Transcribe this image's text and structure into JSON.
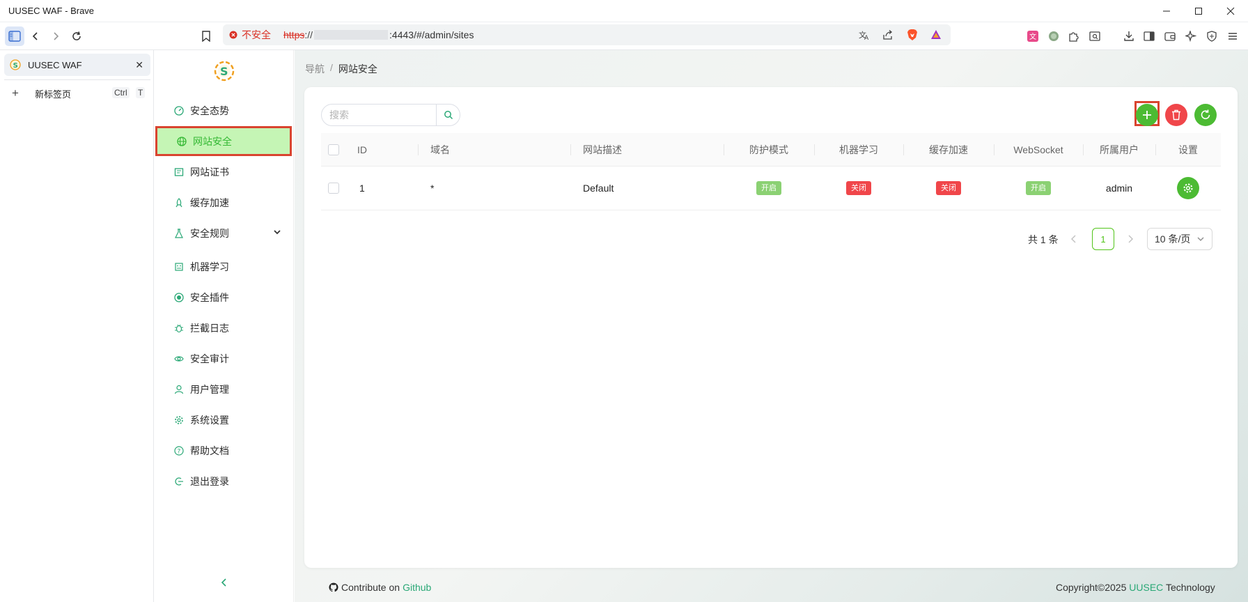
{
  "window": {
    "title": "UUSEC WAF - Brave"
  },
  "browser": {
    "url_security": "不安全",
    "url_protocol": "https",
    "url_separator": "://",
    "url_path": ":4443/#/admin/sites",
    "tab_title": "UUSEC WAF",
    "new_tab_label": "新标签页",
    "new_tab_shortcut_key1": "Ctrl",
    "new_tab_shortcut_key2": "T"
  },
  "sidebar": {
    "items": [
      {
        "label": "安全态势",
        "icon": "dashboard-icon"
      },
      {
        "label": "网站安全",
        "icon": "globe-icon"
      },
      {
        "label": "网站证书",
        "icon": "certificate-icon"
      },
      {
        "label": "缓存加速",
        "icon": "rocket-icon"
      },
      {
        "label": "安全规则",
        "icon": "flask-icon"
      },
      {
        "label": "机器学习",
        "icon": "robot-icon"
      },
      {
        "label": "安全插件",
        "icon": "plugin-icon"
      },
      {
        "label": "拦截日志",
        "icon": "bug-icon"
      },
      {
        "label": "安全审计",
        "icon": "eye-icon"
      },
      {
        "label": "用户管理",
        "icon": "user-icon"
      },
      {
        "label": "系统设置",
        "icon": "gear-icon"
      },
      {
        "label": "帮助文档",
        "icon": "help-icon"
      },
      {
        "label": "退出登录",
        "icon": "logout-icon"
      }
    ],
    "selected_index": 1
  },
  "breadcrumb": {
    "root": "导航",
    "separator": "/",
    "current": "网站安全"
  },
  "search": {
    "placeholder": "搜索",
    "value": ""
  },
  "table": {
    "headers": {
      "id": "ID",
      "domain": "域名",
      "description": "网站描述",
      "protect_mode": "防护模式",
      "ml": "机器学习",
      "cache": "缓存加速",
      "websocket": "WebSocket",
      "owner": "所属用户",
      "settings": "设置"
    },
    "rows": [
      {
        "id": "1",
        "domain": "*",
        "description": "Default",
        "protect_mode": "开启",
        "ml": "关闭",
        "cache": "关闭",
        "websocket": "开启",
        "owner": "admin"
      }
    ]
  },
  "pagination": {
    "total": "共 1 条",
    "current_page": "1",
    "page_size": "10 条/页"
  },
  "footer": {
    "contribute_prefix": "Contribute on",
    "contribute_link": "Github",
    "copyright_prefix": "Copyright©2025",
    "brand": "UUSEC",
    "copyright_suffix": "Technology"
  },
  "colors": {
    "accent_green": "#52c41a",
    "selected_bg": "#c5f5b5",
    "highlight_border": "#d9442f",
    "danger_red": "#f0464a",
    "link_teal": "#2aa876"
  }
}
